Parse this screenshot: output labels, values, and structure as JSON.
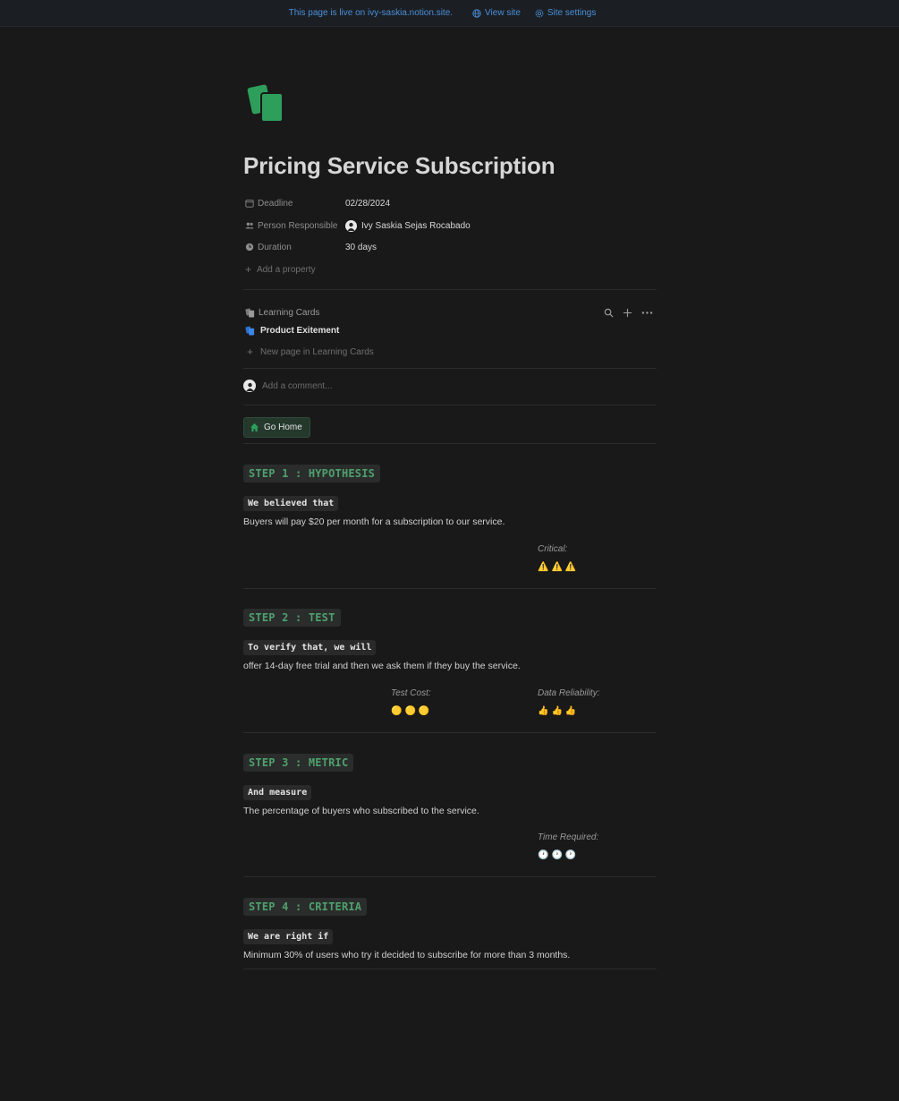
{
  "banner": {
    "live_text": "This page is live on ivy-saskia.notion.site.",
    "view_site": "View site",
    "site_settings": "Site settings"
  },
  "page": {
    "icon": "cards-icon",
    "title": "Pricing Service Subscription"
  },
  "properties": [
    {
      "name": "Deadline",
      "icon": "calendar-icon",
      "value": "02/28/2024"
    },
    {
      "name": "Person Responsible",
      "icon": "people-icon",
      "value": "Ivy Saskia Sejas Rocabado"
    },
    {
      "name": "Duration",
      "icon": "clock-icon",
      "value": "30 days"
    }
  ],
  "add_property": "Add a property",
  "database": {
    "title": "Learning Cards",
    "items": [
      {
        "label": "Product Exitement"
      }
    ],
    "new_page": "New page in Learning Cards"
  },
  "comment": {
    "placeholder": "Add a comment..."
  },
  "home_button": {
    "label": "Go Home"
  },
  "steps": [
    {
      "heading": "STEP 1 : HYPOTHESIS",
      "label": "We believed that",
      "text": "Buyers will pay $20 per month for a subscription to our service.",
      "ratings": [
        {
          "label": "Critical:",
          "value": "⚠️⚠️⚠️"
        }
      ]
    },
    {
      "heading": "STEP 2 : TEST",
      "label": "To verify that, we will",
      "text": "offer 14-day free trial and then we ask them if they buy the service.",
      "ratings": [
        {
          "label": "Test Cost:",
          "value": "🟡🟡🟡"
        },
        {
          "label": "Data Reliability:",
          "value": "👍👍👍"
        }
      ]
    },
    {
      "heading": "STEP 3 : METRIC",
      "label": "And measure",
      "text": "The percentage of buyers who subscribed to the service.",
      "ratings": [
        {
          "label": "Time Required:",
          "value": "🕐🕐🕐"
        }
      ]
    },
    {
      "heading": "STEP 4 : CRITERIA",
      "label": "We are right if",
      "text": "Minimum 30% of users who try it decided to subscribe for more than 3 months.",
      "ratings": []
    }
  ],
  "colors": {
    "background": "#191919",
    "banner_link": "#4a8fd9",
    "step_heading": "#4fa06e",
    "icon_green": "#2e9e5b"
  }
}
